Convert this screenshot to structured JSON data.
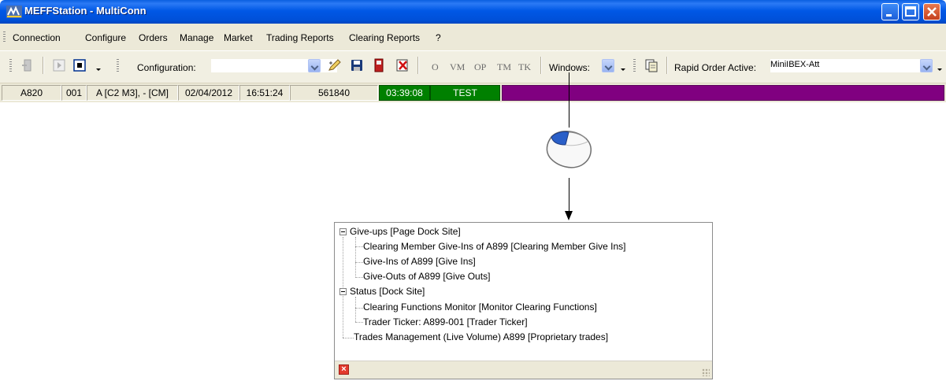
{
  "window": {
    "title": "MEFFStation - MultiConn"
  },
  "menu": [
    "Connection",
    "Configure",
    "Orders",
    "Manage",
    "Market",
    "Trading Reports",
    "Clearing Reports",
    "?"
  ],
  "toolbar": {
    "configuration_label": "Configuration:",
    "configuration_value": "",
    "text_buttons": [
      "O",
      "VM",
      "OP",
      "TM",
      "TK"
    ],
    "windows_label": "Windows:",
    "rapid_order_label": "Rapid Order Active:",
    "rapid_order_value": "MiniIBEX-Att"
  },
  "status": {
    "member": "A820",
    "trader": "001",
    "account": "A [C2 M3], - [CM]",
    "date": "02/04/2012",
    "time": "16:51:24",
    "session_id": "561840",
    "timer": "03:39:08",
    "environment": "TEST",
    "colors": {
      "timer_bg": "#008000",
      "env_bg": "#008000",
      "bar_bg": "#800080"
    }
  },
  "tree": [
    {
      "label": "Give-ups [Page Dock Site]",
      "expanded": true,
      "children": [
        {
          "label": "Clearing Member Give-Ins of A899 [Clearing Member Give Ins]"
        },
        {
          "label": "Give-Ins of A899 [Give Ins]"
        },
        {
          "label": "Give-Outs of A899 [Give Outs]"
        }
      ]
    },
    {
      "label": "Status [Dock Site]",
      "expanded": true,
      "children": [
        {
          "label": "Clearing Functions Monitor [Monitor Clearing Functions]"
        },
        {
          "label": "Trader Ticker: A899-001 [Trader Ticker]"
        }
      ]
    },
    {
      "label": "Trades Management (Live Volume) A899 [Proprietary trades]"
    }
  ],
  "icons": {
    "app": "meff-logo-icon",
    "mouse": "mouse-icon",
    "close": "close-icon"
  }
}
